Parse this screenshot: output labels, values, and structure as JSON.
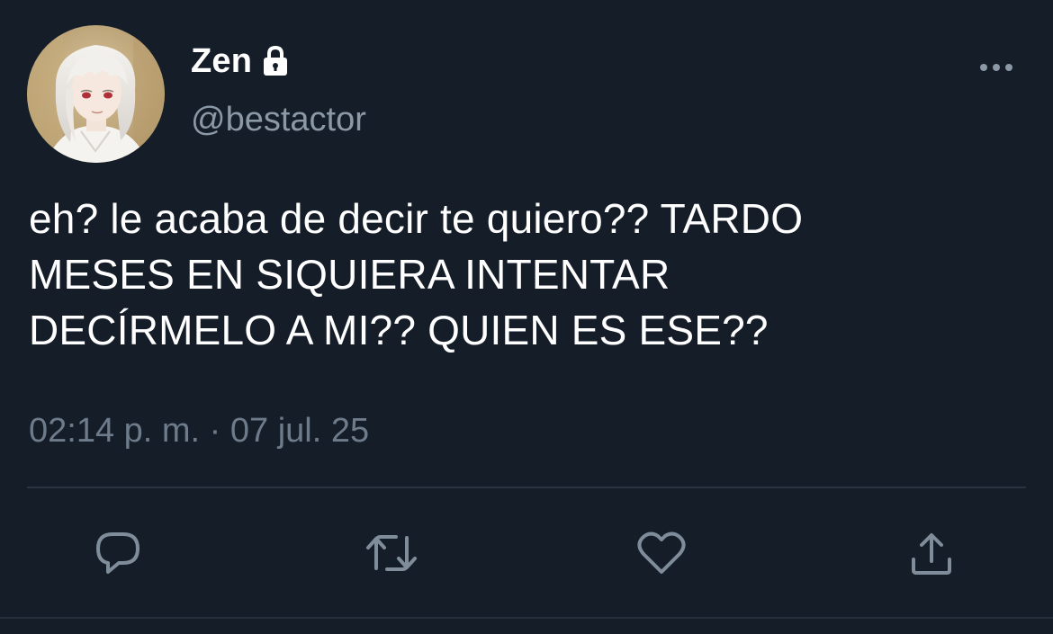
{
  "tweet": {
    "author": {
      "display_name": "Zen",
      "handle": "@bestactor",
      "protected_icon": "lock-icon",
      "avatar": "anime-avatar-white-hair"
    },
    "text_lines": [
      "eh? le acaba de decir te quiero?? TARDO",
      "MESES EN SIQUIERA INTENTAR",
      "DECÍRMELO A MI?? QUIEN ES ESE??"
    ],
    "timestamp": "02:14 p. m. · 07 jul. 25"
  },
  "actions": [
    {
      "name": "reply",
      "icon": "speech-bubble-icon"
    },
    {
      "name": "retweet",
      "icon": "retweet-icon"
    },
    {
      "name": "like",
      "icon": "heart-icon"
    },
    {
      "name": "share",
      "icon": "share-icon"
    }
  ],
  "colors": {
    "background": "#151d29",
    "primary_text": "#ffffff",
    "secondary_text": "#8b98a5",
    "timestamp_text": "#6d7b8a",
    "icon": "#7f8c99",
    "divider": "#2a3440"
  }
}
